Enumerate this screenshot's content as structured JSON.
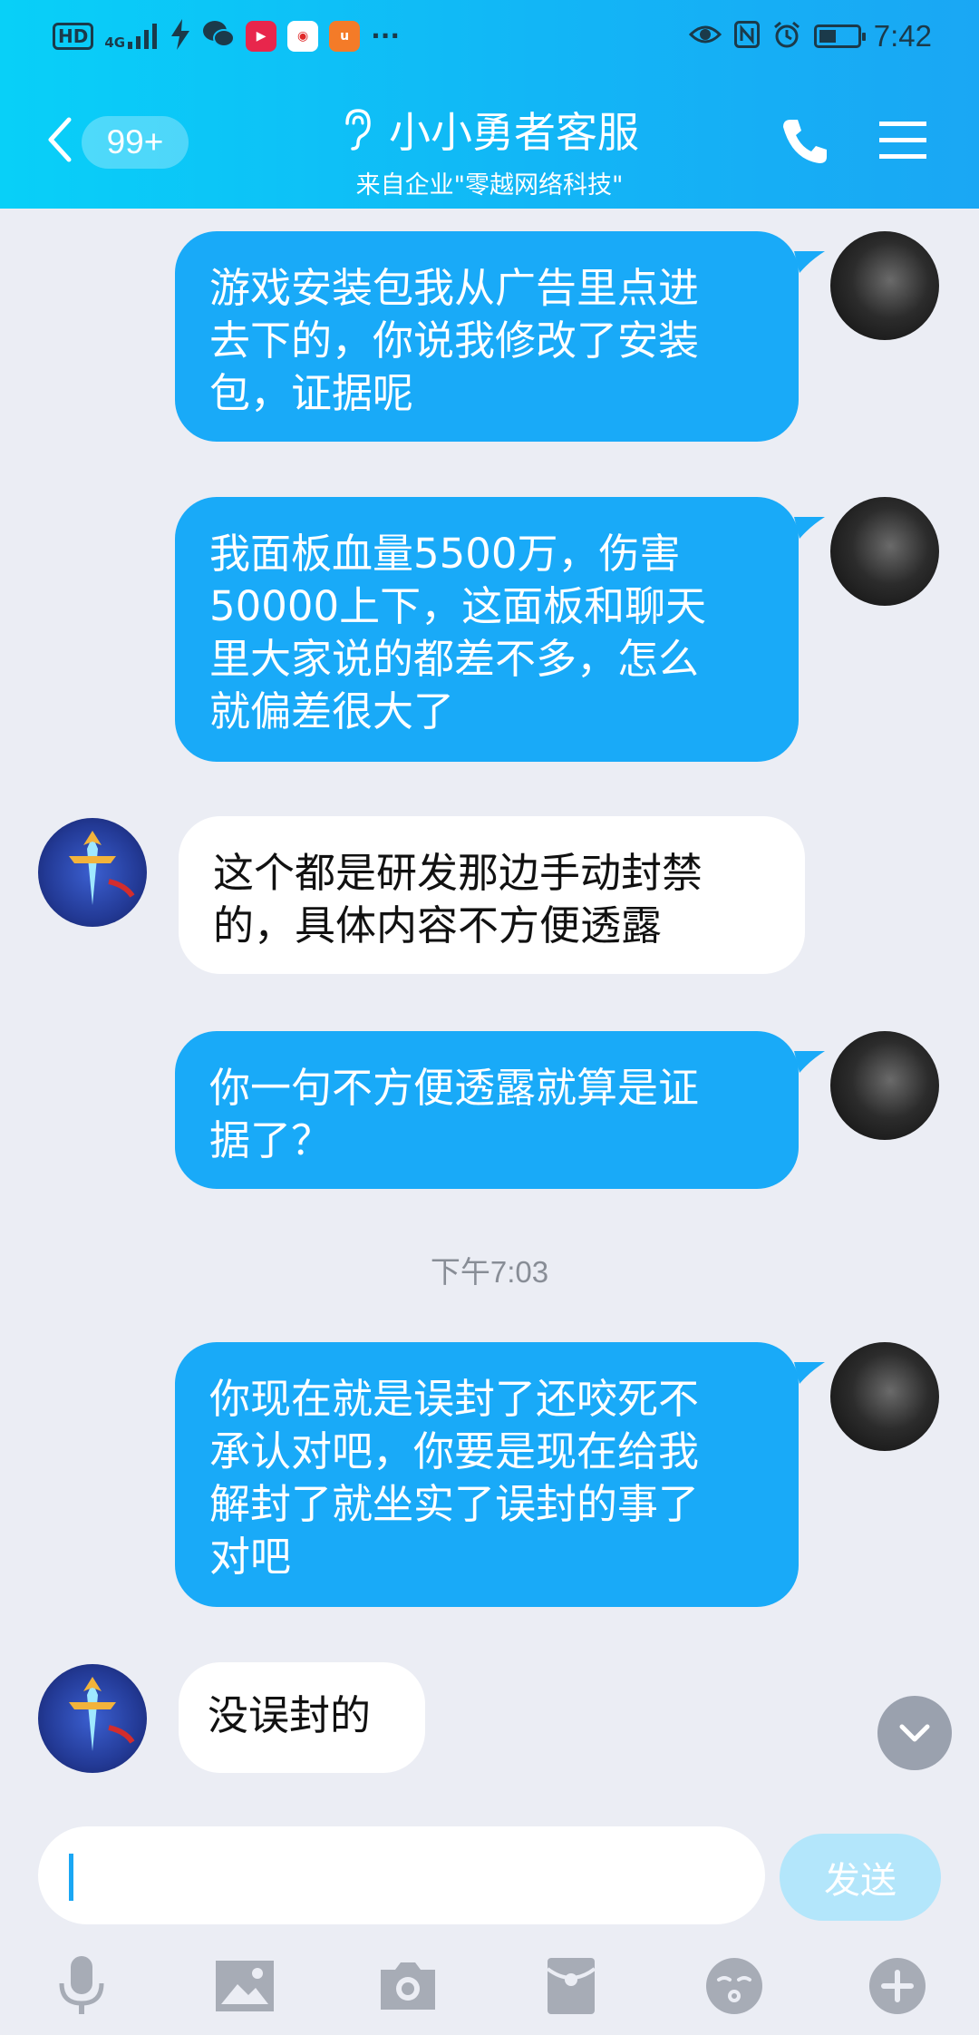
{
  "status_bar": {
    "hd": "HD",
    "network": "4G",
    "time": "7:42",
    "dots": "···",
    "apps": [
      "lightning-icon",
      "wechat-icon",
      "video-app-icon",
      "weibo-app-icon",
      "uc-app-icon"
    ]
  },
  "header": {
    "back_badge": "99+",
    "title": "小小勇者客服",
    "subtitle": "来自企业\"零越网络科技\""
  },
  "messages": [
    {
      "side": "out",
      "lines": [
        "游戏安装包我从广告里点进",
        "去下的，你说我修改了安装",
        "包，证据呢"
      ]
    },
    {
      "side": "out",
      "lines": [
        "我面板血量5500万，伤害",
        "50000上下，这面板和聊天",
        "里大家说的都差不多，怎么",
        "就偏差很大了"
      ]
    },
    {
      "side": "in",
      "lines": [
        "这个都是研发那边手动封禁",
        "的，具体内容不方便透露"
      ]
    },
    {
      "side": "out",
      "lines": [
        "你一句不方便透露就算是证",
        "据了？"
      ]
    },
    {
      "side": "out",
      "lines": [
        "你现在就是误封了还咬死不",
        "承认对吧，你要是现在给我",
        "解封了就坐实了误封的事了",
        "对吧"
      ]
    },
    {
      "side": "in",
      "lines": [
        "没误封的"
      ]
    }
  ],
  "timestamp": "下午7:03",
  "input": {
    "value": "",
    "send_label": "发送"
  },
  "colors": {
    "header_start": "#08d0f8",
    "header_end": "#1aa7f4",
    "bubble_out": "#19aaf8",
    "bubble_in": "#ffffff",
    "background": "#ebedf4",
    "send_disabled": "#b3e6fb"
  }
}
